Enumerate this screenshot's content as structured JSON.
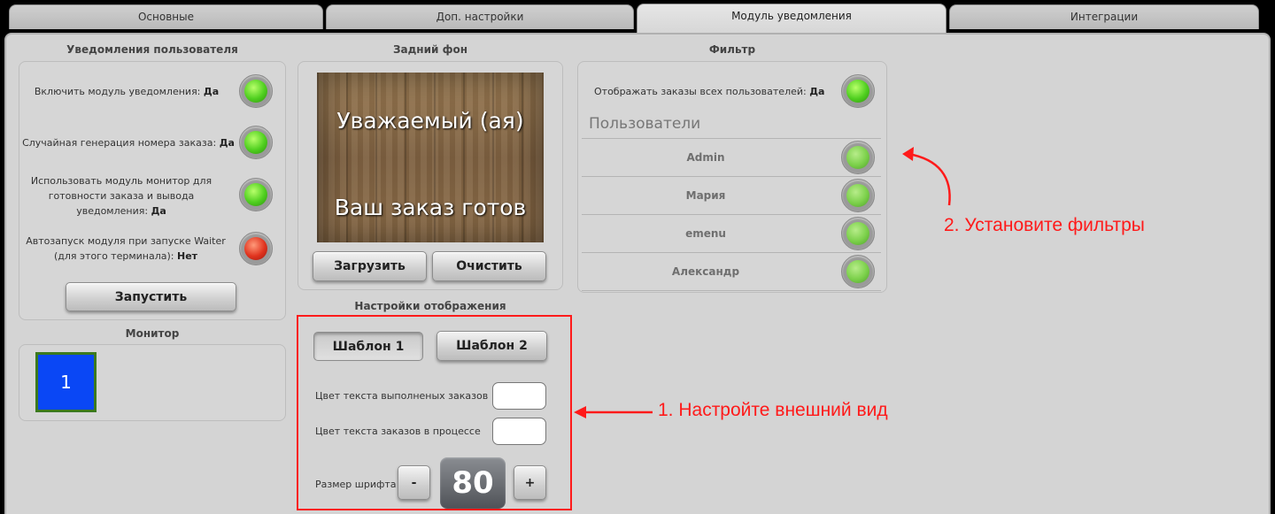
{
  "tabs": [
    {
      "label": "Основные"
    },
    {
      "label": "Доп. настройки"
    },
    {
      "label": "Модуль уведомления"
    },
    {
      "label": "Интеграции"
    }
  ],
  "user_notifications": {
    "title": "Уведомления пользователя",
    "rows": [
      {
        "label": "Включить модуль уведомления:",
        "value": "Да"
      },
      {
        "label": "Случайная генерация номера заказа:",
        "value": "Да"
      },
      {
        "label": "Использовать модуль монитор для готовности заказа и вывода уведомления:",
        "value": "Да"
      },
      {
        "label": "Автозапуск модуля при запуске Waiter (для этого терминала):",
        "value": "Нет"
      }
    ],
    "start_button": "Запустить"
  },
  "monitor": {
    "title": "Монитор",
    "tile": "1"
  },
  "background": {
    "title": "Задний фон",
    "line1": "Уважаемый (ая)",
    "line2": "Ваш заказ готов",
    "load_button": "Загрузить",
    "clear_button": "Очистить"
  },
  "display": {
    "title": "Настройки отображения",
    "template1": "Шаблон 1",
    "template2": "Шаблон 2",
    "done_color_label": "Цвет текста выполненых заказов",
    "progress_color_label": "Цвет текста заказов в процессе",
    "font_size_label": "Размер шрифта",
    "minus": "-",
    "plus": "+",
    "font_size": "80"
  },
  "filter": {
    "title": "Фильтр",
    "show_all_label": "Отображать заказы всех пользователей:",
    "show_all_value": "Да",
    "users_header": "Пользователи",
    "users": [
      {
        "name": "Admin"
      },
      {
        "name": "Мария"
      },
      {
        "name": "emenu"
      },
      {
        "name": "Александр"
      }
    ]
  },
  "annotations": {
    "step1": "1. Настройте внешний вид",
    "step2": "2. Установите фильтры"
  },
  "colors": {
    "annotation": "#ff1a1a",
    "monitor_tile": "#0a47f5"
  }
}
